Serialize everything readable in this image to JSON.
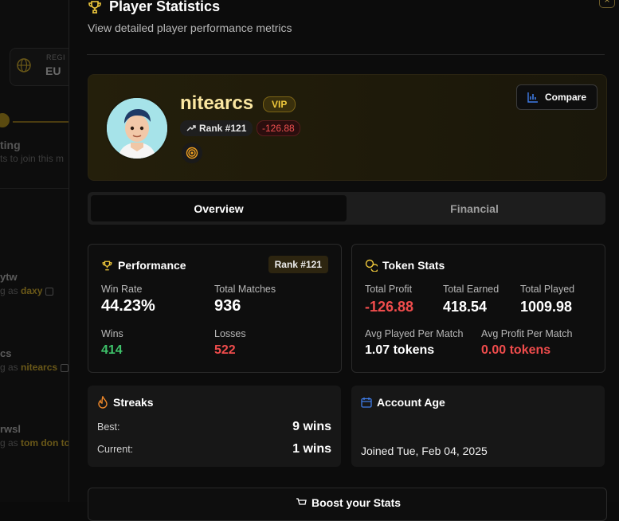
{
  "background": {
    "region_label": "REGI",
    "region_value": "EU",
    "step_title": "ting",
    "step_sub": "ts to join this m",
    "users": [
      {
        "name": "ytw",
        "sub_prefix": "g as ",
        "sub_name": "daxy"
      },
      {
        "name": "cs",
        "sub_prefix": "g as ",
        "sub_name": "nitearcs"
      },
      {
        "name": "rwsl",
        "sub_prefix": "g as ",
        "sub_name": "tom don to"
      }
    ]
  },
  "modal": {
    "title": "Player Statistics",
    "subtitle": "View detailed player performance metrics",
    "close_label": "×"
  },
  "profile": {
    "name": "nitearcs",
    "vip_label": "VIP",
    "rank_label": "Rank #121",
    "profit_label": "-126.88",
    "compare_label": "Compare"
  },
  "tabs": [
    {
      "label": "Overview",
      "active": true
    },
    {
      "label": "Financial",
      "active": false
    }
  ],
  "performance": {
    "title": "Performance",
    "rank_badge": "Rank #121",
    "win_rate_label": "Win Rate",
    "win_rate": "44.23%",
    "total_matches_label": "Total Matches",
    "total_matches": "936",
    "wins_label": "Wins",
    "wins": "414",
    "losses_label": "Losses",
    "losses": "522"
  },
  "token_stats": {
    "title": "Token Stats",
    "total_profit_label": "Total Profit",
    "total_profit": "-126.88",
    "total_earned_label": "Total Earned",
    "total_earned": "418.54",
    "total_played_label": "Total Played",
    "total_played": "1009.98",
    "avg_played_label": "Avg Played Per Match",
    "avg_played": "1.07 tokens",
    "avg_profit_label": "Avg Profit Per Match",
    "avg_profit": "0.00 tokens"
  },
  "streaks": {
    "title": "Streaks",
    "best_label": "Best:",
    "best": "9 wins",
    "current_label": "Current:",
    "current": "1 wins"
  },
  "account_age": {
    "title": "Account Age",
    "joined": "Joined Tue, Feb 04, 2025"
  },
  "boost": {
    "label": "Boost your Stats"
  },
  "colors": {
    "accent_gold": "#f0c93c",
    "positive": "#3ec26a",
    "negative": "#ef4c4c",
    "card_bg": "#0e0e0e"
  }
}
